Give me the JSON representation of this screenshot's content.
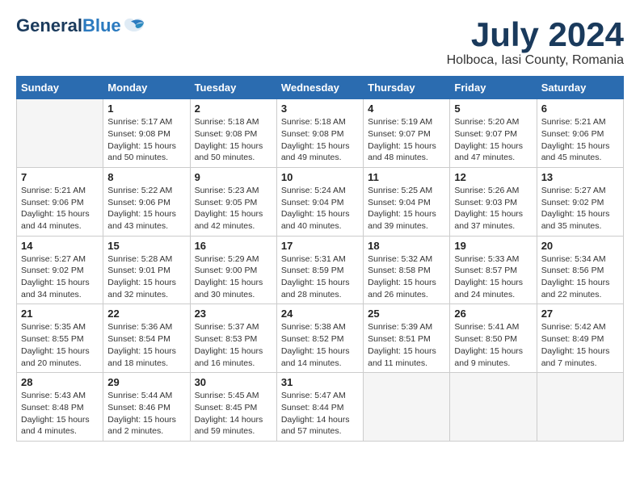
{
  "header": {
    "logo_general": "General",
    "logo_blue": "Blue",
    "title": "July 2024",
    "subtitle": "Holboca, Iasi County, Romania"
  },
  "calendar": {
    "days_of_week": [
      "Sunday",
      "Monday",
      "Tuesday",
      "Wednesday",
      "Thursday",
      "Friday",
      "Saturday"
    ],
    "weeks": [
      [
        {
          "date": "",
          "info": ""
        },
        {
          "date": "1",
          "info": "Sunrise: 5:17 AM\nSunset: 9:08 PM\nDaylight: 15 hours\nand 50 minutes."
        },
        {
          "date": "2",
          "info": "Sunrise: 5:18 AM\nSunset: 9:08 PM\nDaylight: 15 hours\nand 50 minutes."
        },
        {
          "date": "3",
          "info": "Sunrise: 5:18 AM\nSunset: 9:08 PM\nDaylight: 15 hours\nand 49 minutes."
        },
        {
          "date": "4",
          "info": "Sunrise: 5:19 AM\nSunset: 9:07 PM\nDaylight: 15 hours\nand 48 minutes."
        },
        {
          "date": "5",
          "info": "Sunrise: 5:20 AM\nSunset: 9:07 PM\nDaylight: 15 hours\nand 47 minutes."
        },
        {
          "date": "6",
          "info": "Sunrise: 5:21 AM\nSunset: 9:06 PM\nDaylight: 15 hours\nand 45 minutes."
        }
      ],
      [
        {
          "date": "7",
          "info": "Sunrise: 5:21 AM\nSunset: 9:06 PM\nDaylight: 15 hours\nand 44 minutes."
        },
        {
          "date": "8",
          "info": "Sunrise: 5:22 AM\nSunset: 9:06 PM\nDaylight: 15 hours\nand 43 minutes."
        },
        {
          "date": "9",
          "info": "Sunrise: 5:23 AM\nSunset: 9:05 PM\nDaylight: 15 hours\nand 42 minutes."
        },
        {
          "date": "10",
          "info": "Sunrise: 5:24 AM\nSunset: 9:04 PM\nDaylight: 15 hours\nand 40 minutes."
        },
        {
          "date": "11",
          "info": "Sunrise: 5:25 AM\nSunset: 9:04 PM\nDaylight: 15 hours\nand 39 minutes."
        },
        {
          "date": "12",
          "info": "Sunrise: 5:26 AM\nSunset: 9:03 PM\nDaylight: 15 hours\nand 37 minutes."
        },
        {
          "date": "13",
          "info": "Sunrise: 5:27 AM\nSunset: 9:02 PM\nDaylight: 15 hours\nand 35 minutes."
        }
      ],
      [
        {
          "date": "14",
          "info": "Sunrise: 5:27 AM\nSunset: 9:02 PM\nDaylight: 15 hours\nand 34 minutes."
        },
        {
          "date": "15",
          "info": "Sunrise: 5:28 AM\nSunset: 9:01 PM\nDaylight: 15 hours\nand 32 minutes."
        },
        {
          "date": "16",
          "info": "Sunrise: 5:29 AM\nSunset: 9:00 PM\nDaylight: 15 hours\nand 30 minutes."
        },
        {
          "date": "17",
          "info": "Sunrise: 5:31 AM\nSunset: 8:59 PM\nDaylight: 15 hours\nand 28 minutes."
        },
        {
          "date": "18",
          "info": "Sunrise: 5:32 AM\nSunset: 8:58 PM\nDaylight: 15 hours\nand 26 minutes."
        },
        {
          "date": "19",
          "info": "Sunrise: 5:33 AM\nSunset: 8:57 PM\nDaylight: 15 hours\nand 24 minutes."
        },
        {
          "date": "20",
          "info": "Sunrise: 5:34 AM\nSunset: 8:56 PM\nDaylight: 15 hours\nand 22 minutes."
        }
      ],
      [
        {
          "date": "21",
          "info": "Sunrise: 5:35 AM\nSunset: 8:55 PM\nDaylight: 15 hours\nand 20 minutes."
        },
        {
          "date": "22",
          "info": "Sunrise: 5:36 AM\nSunset: 8:54 PM\nDaylight: 15 hours\nand 18 minutes."
        },
        {
          "date": "23",
          "info": "Sunrise: 5:37 AM\nSunset: 8:53 PM\nDaylight: 15 hours\nand 16 minutes."
        },
        {
          "date": "24",
          "info": "Sunrise: 5:38 AM\nSunset: 8:52 PM\nDaylight: 15 hours\nand 14 minutes."
        },
        {
          "date": "25",
          "info": "Sunrise: 5:39 AM\nSunset: 8:51 PM\nDaylight: 15 hours\nand 11 minutes."
        },
        {
          "date": "26",
          "info": "Sunrise: 5:41 AM\nSunset: 8:50 PM\nDaylight: 15 hours\nand 9 minutes."
        },
        {
          "date": "27",
          "info": "Sunrise: 5:42 AM\nSunset: 8:49 PM\nDaylight: 15 hours\nand 7 minutes."
        }
      ],
      [
        {
          "date": "28",
          "info": "Sunrise: 5:43 AM\nSunset: 8:48 PM\nDaylight: 15 hours\nand 4 minutes."
        },
        {
          "date": "29",
          "info": "Sunrise: 5:44 AM\nSunset: 8:46 PM\nDaylight: 15 hours\nand 2 minutes."
        },
        {
          "date": "30",
          "info": "Sunrise: 5:45 AM\nSunset: 8:45 PM\nDaylight: 14 hours\nand 59 minutes."
        },
        {
          "date": "31",
          "info": "Sunrise: 5:47 AM\nSunset: 8:44 PM\nDaylight: 14 hours\nand 57 minutes."
        },
        {
          "date": "",
          "info": ""
        },
        {
          "date": "",
          "info": ""
        },
        {
          "date": "",
          "info": ""
        }
      ]
    ]
  }
}
